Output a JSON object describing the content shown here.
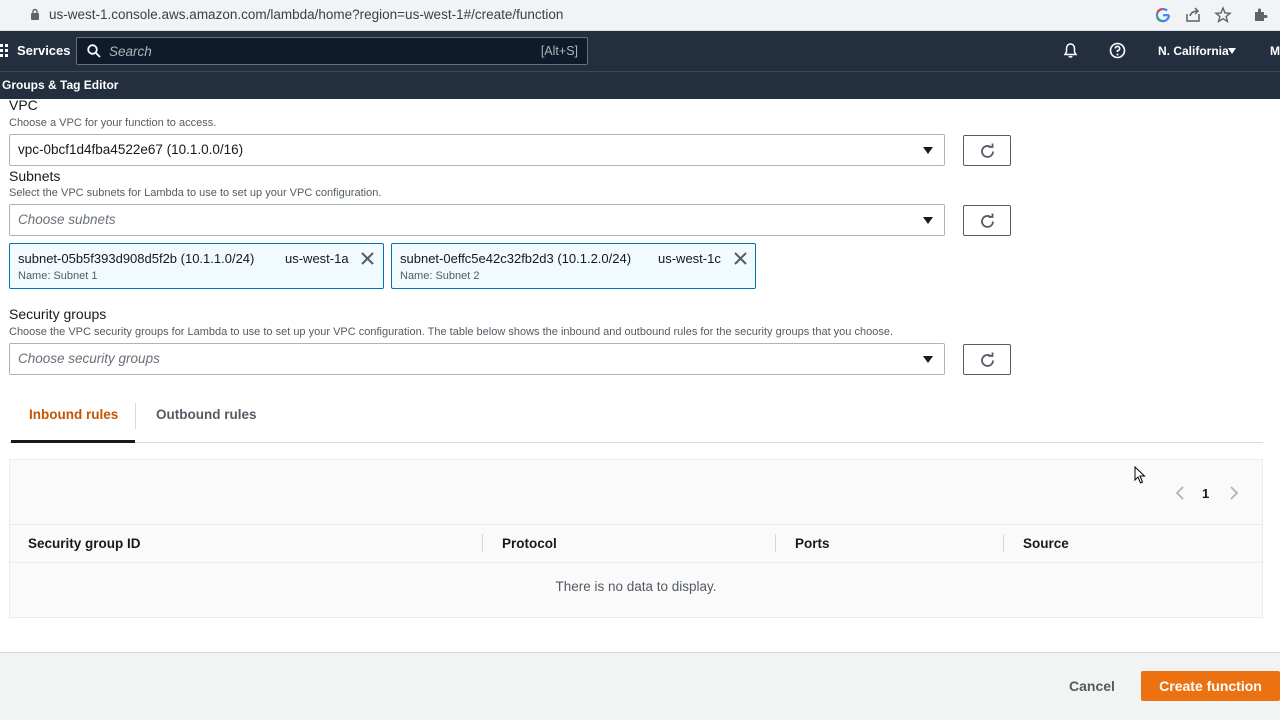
{
  "browser": {
    "url": "us-west-1.console.aws.amazon.com/lambda/home?region=us-west-1#/create/function",
    "icons": [
      "lock-icon",
      "google-icon",
      "share-icon",
      "star-icon",
      "extensions-icon"
    ]
  },
  "topnav": {
    "services_label": "Services",
    "search_placeholder": "Search",
    "search_shortcut": "[Alt+S]",
    "region": "N. California",
    "account": "M",
    "icons": [
      "services-grid-icon",
      "search-icon",
      "bell-icon",
      "help-icon",
      "caret-down-icon"
    ]
  },
  "subnav": {
    "link": "Groups & Tag Editor"
  },
  "vpc": {
    "label": "VPC",
    "description": "Choose a VPC for your function to access.",
    "value": "vpc-0bcf1d4fba4522e67 (10.1.0.0/16)"
  },
  "subnets": {
    "label": "Subnets",
    "description": "Select the VPC subnets for Lambda to use to set up your VPC configuration.",
    "placeholder": "Choose subnets",
    "selected": [
      {
        "id": "subnet-05b5f393d908d5f2b (10.1.1.0/24)",
        "az": "us-west-1a",
        "name": "Name: Subnet 1"
      },
      {
        "id": "subnet-0effc5e42c32fb2d3 (10.1.2.0/24)",
        "az": "us-west-1c",
        "name": "Name: Subnet 2"
      }
    ]
  },
  "security_groups": {
    "label": "Security groups",
    "description": "Choose the VPC security groups for Lambda to use to set up your VPC configuration. The table below shows the inbound and outbound rules for the security groups that you choose.",
    "placeholder": "Choose security groups"
  },
  "tabs": [
    {
      "label": "Inbound rules",
      "active": true
    },
    {
      "label": "Outbound rules",
      "active": false
    }
  ],
  "table": {
    "page": "1",
    "columns": [
      "Security group ID",
      "Protocol",
      "Ports",
      "Source"
    ],
    "empty_text": "There is no data to display."
  },
  "footer": {
    "cancel_label": "Cancel",
    "create_label": "Create function"
  },
  "colors": {
    "nav_bg": "#232f3e",
    "accent": "#ec7211",
    "active_tab": "#c45500",
    "token_border": "#0073bb"
  }
}
